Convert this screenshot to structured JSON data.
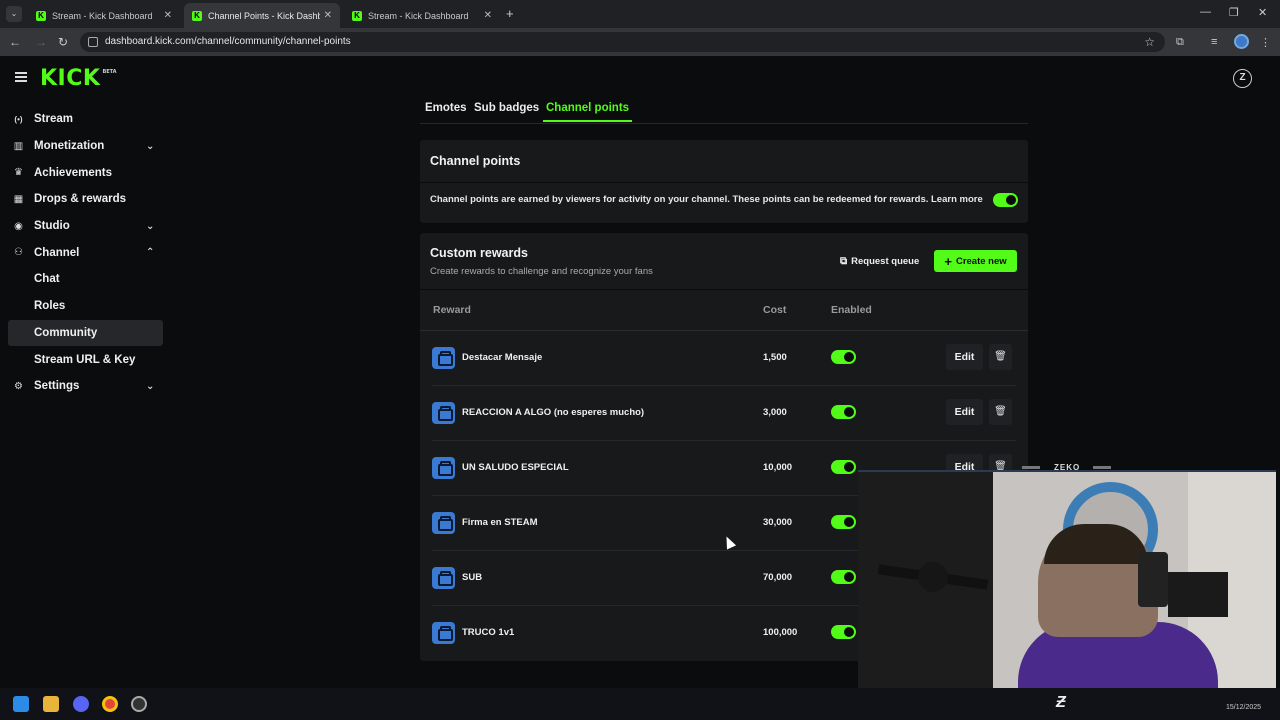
{
  "browser": {
    "tabs": [
      {
        "title": "Stream - Kick Dashboard",
        "favicon": "K"
      },
      {
        "title": "Channel Points - Kick Dashboard",
        "favicon": "K"
      },
      {
        "title": "Stream - Kick Dashboard",
        "favicon": "K"
      }
    ],
    "url": "dashboard.kick.com/channel/community/channel-points"
  },
  "header": {
    "logo": "KICK",
    "logo_badge": "BETA",
    "user_avatar_letter": "Z"
  },
  "sidebar": {
    "items": [
      {
        "label": "Stream",
        "icon": "broadcast-icon",
        "glyph": "((·))"
      },
      {
        "label": "Monetization",
        "icon": "chart-icon",
        "glyph": "▥",
        "chevron": "down"
      },
      {
        "label": "Achievements",
        "icon": "trophy-icon",
        "glyph": "🏆"
      },
      {
        "label": "Drops & rewards",
        "icon": "gift-icon",
        "glyph": "▦"
      },
      {
        "label": "Studio",
        "icon": "studio-icon",
        "glyph": "◉",
        "chevron": "down"
      },
      {
        "label": "Channel",
        "icon": "users-icon",
        "glyph": "👥",
        "chevron": "up"
      },
      {
        "label": "Chat",
        "sub": true
      },
      {
        "label": "Roles",
        "sub": true
      },
      {
        "label": "Community",
        "sub": true,
        "selected": true
      },
      {
        "label": "Stream URL & Key",
        "sub": true
      },
      {
        "label": "Settings",
        "icon": "gear-icon",
        "glyph": "⚙",
        "chevron": "down"
      }
    ]
  },
  "content_tabs": [
    "Emotes",
    "Sub badges",
    "Channel points"
  ],
  "channel_points": {
    "title": "Channel points",
    "description": "Channel points are earned by viewers for activity on your channel. These points can be redeemed for rewards. Learn more",
    "enabled": true
  },
  "custom_rewards": {
    "title": "Custom rewards",
    "subtitle": "Create rewards to challenge and recognize your fans",
    "request_queue_label": "Request queue",
    "create_new_label": "Create new",
    "columns": {
      "reward": "Reward",
      "cost": "Cost",
      "enabled": "Enabled"
    },
    "edit_label": "Edit",
    "rows": [
      {
        "name": "Destacar Mensaje",
        "cost": "1,500",
        "enabled": true
      },
      {
        "name": "REACCION A ALGO (no esperes mucho)",
        "cost": "3,000",
        "enabled": true
      },
      {
        "name": "UN SALUDO ESPECIAL",
        "cost": "10,000",
        "enabled": true
      },
      {
        "name": "Firma en STEAM",
        "cost": "30,000",
        "enabled": true
      },
      {
        "name": "SUB",
        "cost": "70,000",
        "enabled": true
      },
      {
        "name": "TRUCO 1v1",
        "cost": "100,000",
        "enabled": true
      }
    ]
  },
  "webcam": {
    "label": "ZEKO"
  },
  "taskbar": {
    "date": "15/12/2025"
  },
  "colors": {
    "accent": "#53fc18",
    "background": "#0b0c0d",
    "card": "#18191b",
    "reward_icon": "#3a7ad3"
  }
}
